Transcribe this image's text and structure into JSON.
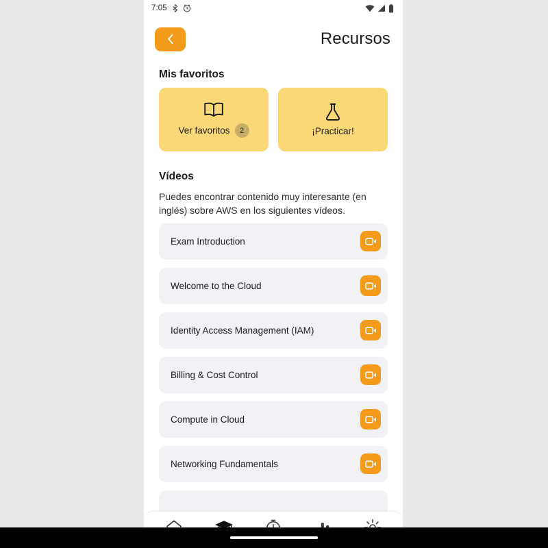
{
  "statusbar": {
    "time": "7:05",
    "left_icons": [
      "bluetooth-icon",
      "alarm-icon"
    ],
    "right_icons": [
      "wifi-icon",
      "cellular-signal-icon",
      "battery-icon"
    ]
  },
  "header": {
    "back_icon": "chevron-left-icon",
    "title": "Recursos",
    "accent_color": "#f59b1c"
  },
  "favorites": {
    "section_title": "Mis favoritos",
    "card_color": "#fad877",
    "badge_color": "#c6ae67",
    "cards": [
      {
        "icon": "open-book-icon",
        "label": "Ver favoritos",
        "badge": "2"
      },
      {
        "icon": "flask-icon",
        "label": "¡Practicar!",
        "badge": ""
      }
    ]
  },
  "videos": {
    "section_title": "Vídeos",
    "description": "Puedes encontrar contenido muy interesante (en inglés) sobre AWS en los siguientes vídeos.",
    "row_color": "#f1f1f6",
    "button_color": "#f59b1c",
    "button_icon": "video-camera-icon",
    "items": [
      {
        "title": "Exam Introduction"
      },
      {
        "title": "Welcome to the Cloud"
      },
      {
        "title": "Identity Access Management (IAM)"
      },
      {
        "title": "Billing & Cost Control"
      },
      {
        "title": "Compute in Cloud"
      },
      {
        "title": "Networking Fundamentals"
      },
      {
        "title": ""
      }
    ]
  },
  "bottom_nav": {
    "items": [
      {
        "icon": "home-icon",
        "active": false
      },
      {
        "icon": "graduation-cap-icon",
        "active": true
      },
      {
        "icon": "stopwatch-icon",
        "active": false
      },
      {
        "icon": "bar-chart-icon",
        "active": false
      },
      {
        "icon": "gear-icon",
        "active": false
      }
    ]
  }
}
